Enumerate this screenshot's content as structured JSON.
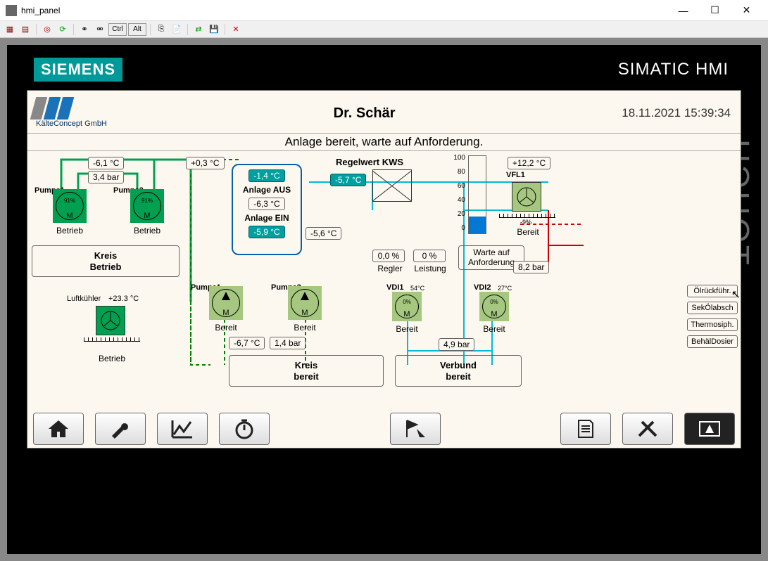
{
  "window": {
    "title": "hmi_panel",
    "min": "—",
    "max": "☐",
    "close": "✕"
  },
  "bezel": {
    "brand": "SIEMENS",
    "product": "SIMATIC HMI",
    "side": "TOUCH"
  },
  "header": {
    "logo_sub": "KälteConcept GmbH",
    "customer": "Dr. Schär",
    "timestamp": "18.11.2021 15:39:34"
  },
  "status_line": "Anlage bereit, warte auf Anforderung.",
  "circuit1": {
    "pump1_label": "Pumpe1",
    "pump1_pct": "91%",
    "pump1_m": "M",
    "pump1_state": "Betrieb",
    "pump2_label": "Pumpe2",
    "pump2_pct": "91%",
    "pump2_m": "M",
    "pump2_state": "Betrieb",
    "temp": "-6,1 °C",
    "press": "3,4 bar",
    "box_line1": "Kreis",
    "box_line2": "Betrieb"
  },
  "aircooler": {
    "label": "Luftkühler",
    "temp": "+23.3 °C",
    "state": "Betrieb",
    "ruler_val": ""
  },
  "anlage": {
    "in_temp": "+0,3 °C",
    "top_val": "-1,4 °C",
    "aus_label": "Anlage AUS",
    "mid_val": "-6,3 °C",
    "ein_label": "Anlage EIN",
    "bot_val": "-5,9 °C",
    "out_val": "-5,6 °C"
  },
  "circuit2": {
    "pump3_label": "Pumpe1",
    "pump3_m": "M",
    "pump3_state": "Bereit",
    "pump4_label": "Pumpe2",
    "pump4_m": "M",
    "pump4_state": "Bereit",
    "temp": "-6,7 °C",
    "press": "1,4 bar",
    "box_line1": "Kreis",
    "box_line2": "bereit"
  },
  "kws": {
    "label": "Regelwert KWS",
    "val": "-5,7 °C",
    "regler_val": "0,0 %",
    "regler_lbl": "Regler",
    "leistung_val": "0 %",
    "leistung_lbl": "Leistung",
    "status_line1": "Warte auf",
    "status_line2": "Anforderung",
    "press": "8,2 bar",
    "low_press": "4,9 bar"
  },
  "bargraph": {
    "s100": "100",
    "s80": "80",
    "s60": "60",
    "s40": "40",
    "s20": "20",
    "s0": "0",
    "value_pct": 22
  },
  "vfl": {
    "temp": "+12,2 °C",
    "label": "VFL1",
    "state": "Bereit",
    "ruler_val": "-9%"
  },
  "vdi1": {
    "label": "VDI1",
    "sub": "54°C",
    "pct": "0%",
    "m": "M",
    "state": "Bereit"
  },
  "vdi2": {
    "label": "VDI2",
    "sub": "27°C",
    "pct": "0%",
    "m": "M",
    "state": "Bereit"
  },
  "verbund": {
    "box_line1": "Verbund",
    "box_line2": "bereit"
  },
  "side_buttons": {
    "b1": "Ölrückführ.",
    "b2": "SekÖlabsch",
    "b3": "Thermosiph.",
    "b4": "BehälDosier"
  }
}
